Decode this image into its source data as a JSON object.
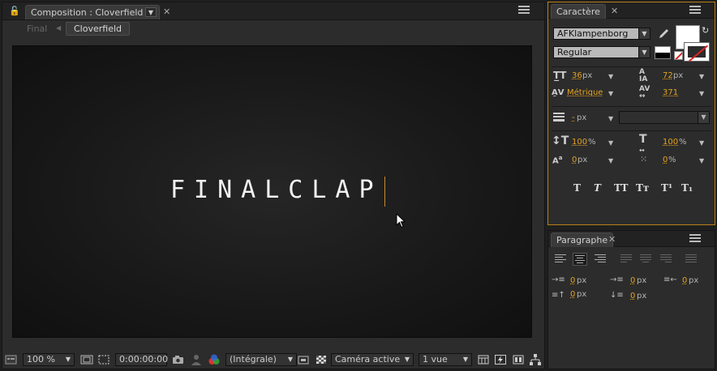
{
  "composition": {
    "tab_title": "Composition : Cloverfield",
    "breadcrumb_final": "Final",
    "breadcrumb_current": "Cloverfield",
    "viewer_text": "FINALCLAP"
  },
  "toolbar": {
    "zoom": "100 %",
    "timecode": "0:00:00:00",
    "resolution": "(Intégrale)",
    "camera": "Caméra active",
    "views": "1 vue"
  },
  "character": {
    "tab_title": "Caractère",
    "font_family": "AFKlampenborg",
    "font_style": "Regular",
    "font_size": "36",
    "font_size_unit": "px",
    "leading": "72",
    "leading_unit": "px",
    "kerning": "Métrique",
    "tracking": "371",
    "stroke_width": "-",
    "stroke_unit": "px",
    "vertical_scale": "100",
    "vertical_scale_unit": "%",
    "horizontal_scale": "100",
    "horizontal_scale_unit": "%",
    "baseline_shift": "0",
    "baseline_shift_unit": "px",
    "tsume": "0",
    "tsume_unit": "%",
    "style_buttons": [
      "T",
      "T",
      "TT",
      "Tт",
      "T¹",
      "T₁"
    ]
  },
  "paragraph": {
    "tab_title": "Paragraphe",
    "indent_left": "0",
    "indent_first": "0",
    "indent_right": "0",
    "space_before": "0",
    "space_after": "0",
    "unit": "px"
  },
  "colors": {
    "accent": "#e4a21f",
    "panel_bg": "#2c2c2c",
    "viewer_bg": "#141414"
  }
}
